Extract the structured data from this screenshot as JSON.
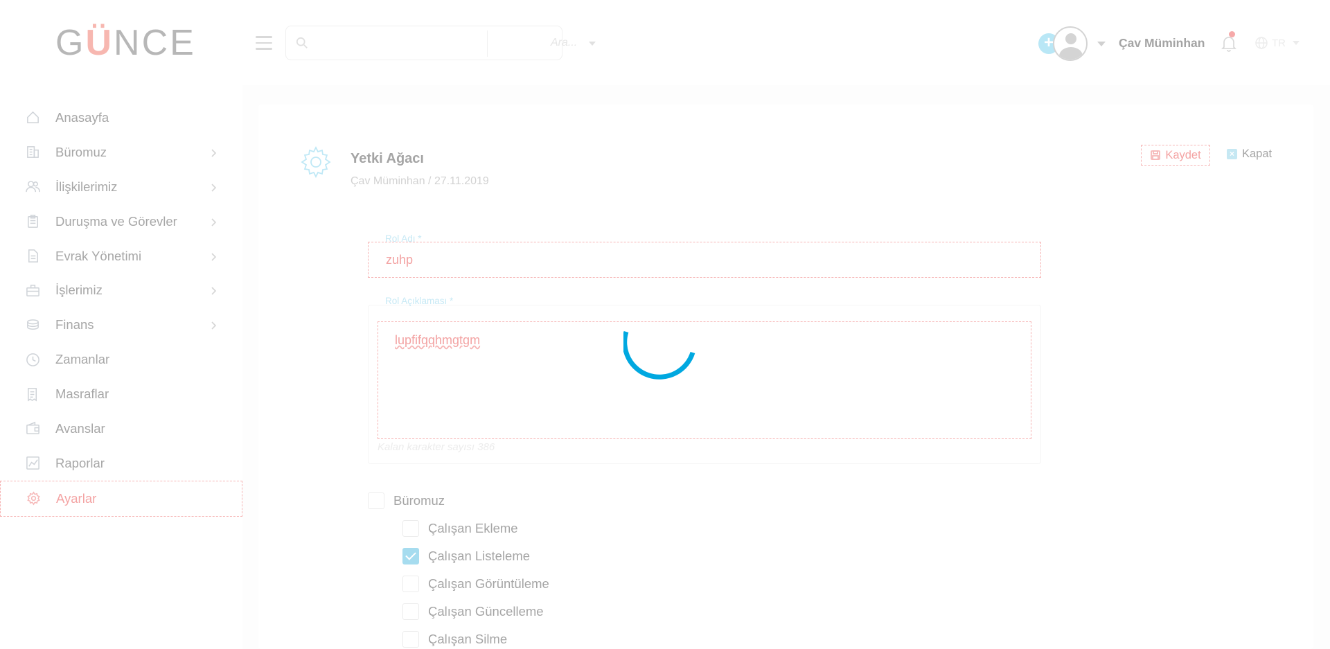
{
  "brand": {
    "logo_left": "G",
    "logo_o": "Ü",
    "logo_right": "NCE"
  },
  "sidebar": {
    "items": [
      {
        "label": "Anasayfa",
        "icon": "home-icon",
        "has_children": false
      },
      {
        "label": "Büromuz",
        "icon": "building-icon",
        "has_children": true
      },
      {
        "label": "İlişkilerimiz",
        "icon": "users-icon",
        "has_children": true
      },
      {
        "label": "Duruşma ve Görevler",
        "icon": "clipboard-icon",
        "has_children": true
      },
      {
        "label": "Evrak Yönetimi",
        "icon": "document-icon",
        "has_children": true
      },
      {
        "label": "İşlerimiz",
        "icon": "briefcase-icon",
        "has_children": true
      },
      {
        "label": "Finans",
        "icon": "coins-icon",
        "has_children": true
      },
      {
        "label": "Zamanlar",
        "icon": "clock-icon",
        "has_children": false
      },
      {
        "label": "Masraflar",
        "icon": "receipt-icon",
        "has_children": false
      },
      {
        "label": "Avanslar",
        "icon": "wallet-icon",
        "has_children": false
      },
      {
        "label": "Raporlar",
        "icon": "chart-icon",
        "has_children": false
      },
      {
        "label": "Ayarlar",
        "icon": "gear-icon",
        "has_children": false,
        "active": true
      }
    ]
  },
  "topbar": {
    "search_placeholder": "",
    "search_scope": "Ara...",
    "username": "Çav Müminhan",
    "language": "TR"
  },
  "page": {
    "title": "Yetki Ağacı",
    "subtitle": "Çav Müminhan / 27.11.2019",
    "save_label": "Kaydet",
    "close_label": "Kapat"
  },
  "form": {
    "role_name_label": "Rol Adı *",
    "role_name_value": "zuhp",
    "role_desc_label": "Rol Açıklaması *",
    "role_desc_value": "lupfifqqhmgtgm",
    "char_count_text": "Kalan karakter sayısı 386"
  },
  "permissions": {
    "group_label": "Büromuz",
    "group_checked": false,
    "items": [
      {
        "label": "Çalışan Ekleme",
        "checked": false
      },
      {
        "label": "Çalışan Listeleme",
        "checked": true
      },
      {
        "label": "Çalışan Görüntüleme",
        "checked": false
      },
      {
        "label": "Çalışan Güncelleme",
        "checked": false
      },
      {
        "label": "Çalışan Silme",
        "checked": false
      }
    ]
  },
  "colors": {
    "accent": "#00a8e0",
    "danger_dashed": "#f6b3b3",
    "text_muted": "#a5a5a5"
  }
}
